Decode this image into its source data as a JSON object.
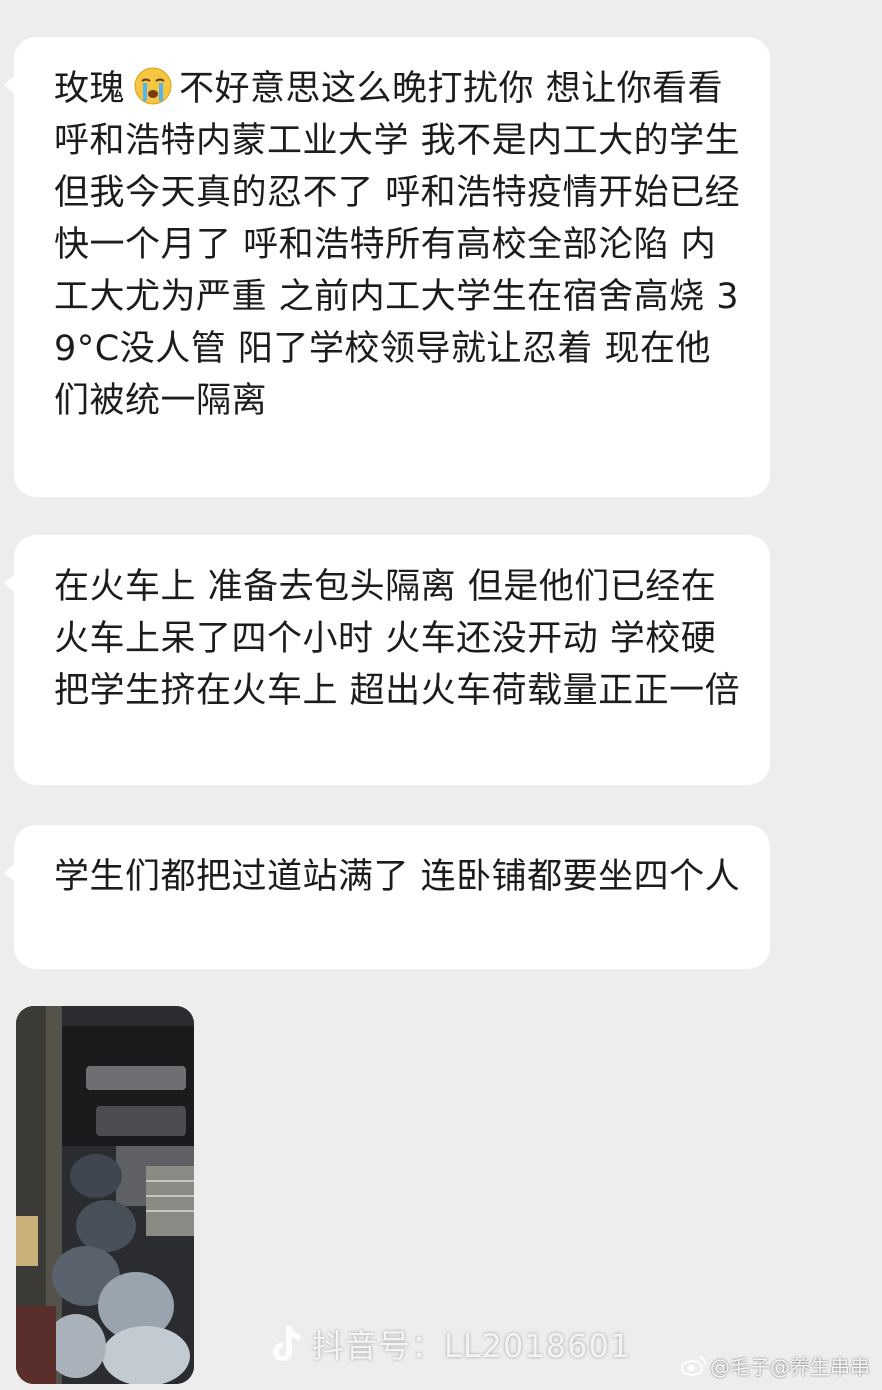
{
  "messages": [
    {
      "id": "msg1",
      "text_before_emoji": "玫瑰",
      "emoji": "crying-face",
      "text_after_emoji": "不好意思这么晚打扰你 想让你看看呼和浩特内蒙工业大学 我不是内工大的学生但我今天真的忍不了 呼和浩特疫情开始已经快一个月了 呼和浩特所有高校全部沦陷 内工大尤为严重 之前内工大学生在宿舍高烧 39°C没人管 阳了学校领导就让忍着 现在他们被统一隔离"
    },
    {
      "id": "msg2",
      "text": "在火车上 准备去包头隔离 但是他们已经在火车上呆了四个小时 火车还没开动 学校硬把学生挤在火车上 超出火车荷载量正正一倍"
    },
    {
      "id": "msg3",
      "text": "学生们都把过道站满了 连卧铺都要坐四个人"
    }
  ],
  "watermark": {
    "platform_icon": "tiktok-icon",
    "text": "抖音号：LL2018601"
  },
  "weibo_watermark": {
    "icon": "weibo-icon",
    "text": "@毛子@养生串串"
  },
  "colors": {
    "background": "#ededed",
    "bubble": "#ffffff",
    "text": "#1c1c1c"
  }
}
